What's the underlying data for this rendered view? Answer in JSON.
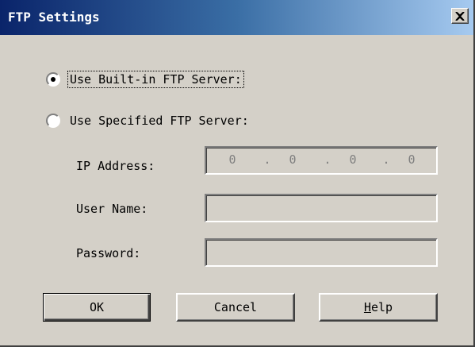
{
  "window": {
    "title": "FTP Settings",
    "close_icon": "close-x-icon"
  },
  "options": {
    "builtin_label": "Use Built-in FTP Server:",
    "specified_label": "Use Specified FTP Server:",
    "selected": "builtin"
  },
  "fields": {
    "ip_label": "IP Address:",
    "ip_octets": [
      "0",
      "0",
      "0",
      "0"
    ],
    "ip_separator": ".",
    "user_label": "User Name:",
    "user_value": "",
    "password_label": "Password:",
    "password_value": ""
  },
  "buttons": {
    "ok": "OK",
    "cancel": "Cancel",
    "help_first": "H",
    "help_rest": "elp"
  },
  "colors": {
    "face": "#d4d0c8",
    "title_start": "#0a246a",
    "title_end": "#a6caf0",
    "disabled_text": "#808080"
  }
}
